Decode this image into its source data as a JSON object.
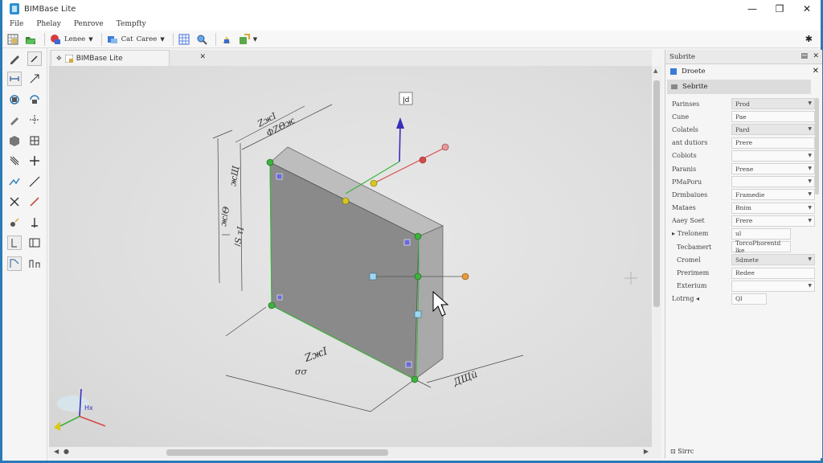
{
  "window": {
    "title": "BIMBase Lite",
    "minimize": "—",
    "maximize": "❐",
    "close": "✕"
  },
  "menu": [
    "File",
    "Phelay",
    "Penrove",
    "Tempfty"
  ],
  "toolbar": {
    "layer_label": "Lenee",
    "cat_label": "Cat",
    "cat2_label": "Caree"
  },
  "doc_tab": {
    "label": "BIMBase Lite",
    "close": "✕"
  },
  "viewport": {
    "top_marker": "ǀd",
    "dimensions": {
      "top_a": "ZжӀ",
      "top_b": "ΦZΘж",
      "left_a": "жǀΘ",
      "left_b": "жЩ",
      "left_c": "ǀS τӀ",
      "bottom": "ZжӀ",
      "bottom2": "σσ",
      "right": "ДЩй"
    },
    "axis_label": "Hx"
  },
  "panel": {
    "title": "Subrite",
    "sub_title": "Droete",
    "selected": "Sebrite",
    "properties": [
      {
        "key": "Parinses",
        "value": "Prod",
        "shaded": true,
        "dropdown": true
      },
      {
        "key": "Cune",
        "value": "Pae",
        "shaded": false,
        "dropdown": false
      },
      {
        "key": "Colatels",
        "value": "Pard",
        "shaded": true,
        "dropdown": true
      },
      {
        "key": "ant dutiors",
        "value": "Prere",
        "shaded": false,
        "dropdown": false
      },
      {
        "key": "Cobiots",
        "value": "",
        "shaded": false,
        "dropdown": true
      },
      {
        "key": "Paranis",
        "value": "Prene",
        "shaded": false,
        "dropdown": true
      },
      {
        "key": "PMaPoru",
        "value": "",
        "shaded": false,
        "dropdown": true
      },
      {
        "key": "Drmbaiues",
        "value": "Framedie",
        "shaded": false,
        "dropdown": true
      },
      {
        "key": "Mataes",
        "value": "Bnim",
        "shaded": false,
        "dropdown": true
      },
      {
        "key": "Aaey Soet",
        "value": "Frere",
        "shaded": false,
        "dropdown": true
      }
    ],
    "group": {
      "key": "Trelonem",
      "value": "ul",
      "children": [
        {
          "key": "Tecbamert",
          "value": "TorcoPhorentd lke",
          "shaded": false,
          "dropdown": false
        },
        {
          "key": "Cromel",
          "value": "Sdmete",
          "shaded": true,
          "dropdown": true
        },
        {
          "key": "Prerimem",
          "value": "Redee",
          "shaded": false,
          "dropdown": false
        },
        {
          "key": "Exterium",
          "value": "",
          "shaded": false,
          "dropdown": true
        }
      ]
    },
    "last": {
      "key": "Lotrng",
      "value": "Ql"
    },
    "footer": "⊡ Sirrc"
  },
  "colors": {
    "accent": "#2a7ab8",
    "wall_face": "#8a8a8a",
    "wall_side": "#a9a9a9",
    "wall_top": "#bdbdbd",
    "grip_green": "#3db33d",
    "axis_blue": "#3a2fb8",
    "axis_red": "#d84a4a",
    "grip_orange": "#e69a3a",
    "grip_yellow": "#d8c81a",
    "grip_cyan": "#9cd8f0"
  }
}
